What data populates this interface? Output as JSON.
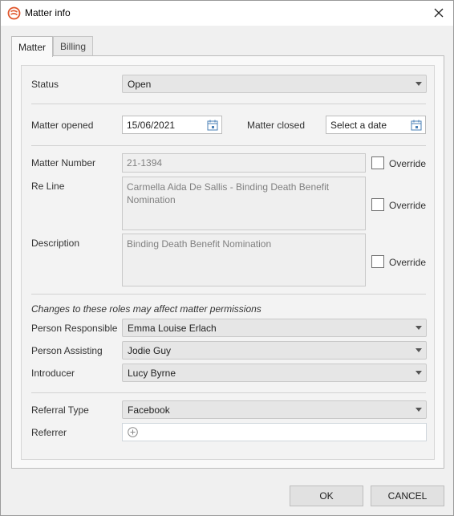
{
  "window": {
    "title": "Matter info"
  },
  "tabs": [
    {
      "label": "Matter"
    },
    {
      "label": "Billing"
    }
  ],
  "status": {
    "label": "Status",
    "value": "Open"
  },
  "dates": {
    "opened_label": "Matter opened",
    "opened_value": "15/06/2021",
    "closed_label": "Matter closed",
    "closed_placeholder": "Select a date"
  },
  "matter_number": {
    "label": "Matter Number",
    "value": "21-1394",
    "override_label": "Override"
  },
  "re_line": {
    "label": "Re Line",
    "value": "Carmella Aida De Sallis - Binding Death Benefit Nomination",
    "override_label": "Override"
  },
  "description": {
    "label": "Description",
    "value": "Binding Death Benefit Nomination",
    "override_label": "Override"
  },
  "roles": {
    "note": "Changes to these roles may affect matter permissions",
    "person_responsible": {
      "label": "Person Responsible",
      "value": "Emma Louise Erlach"
    },
    "person_assisting": {
      "label": "Person Assisting",
      "value": "Jodie Guy"
    },
    "introducer": {
      "label": "Introducer",
      "value": "Lucy Byrne"
    }
  },
  "referral": {
    "type_label": "Referral Type",
    "type_value": "Facebook",
    "referrer_label": "Referrer"
  },
  "buttons": {
    "ok": "OK",
    "cancel": "CANCEL"
  },
  "colors": {
    "accent_icon": "#e0562c",
    "calendar_icon": "#4a7fb5"
  },
  "icons": {
    "app": "app-logo-icon",
    "close": "close-icon",
    "calendar": "calendar-icon",
    "dropdown": "chevron-down-icon",
    "add": "add-circle-icon"
  }
}
